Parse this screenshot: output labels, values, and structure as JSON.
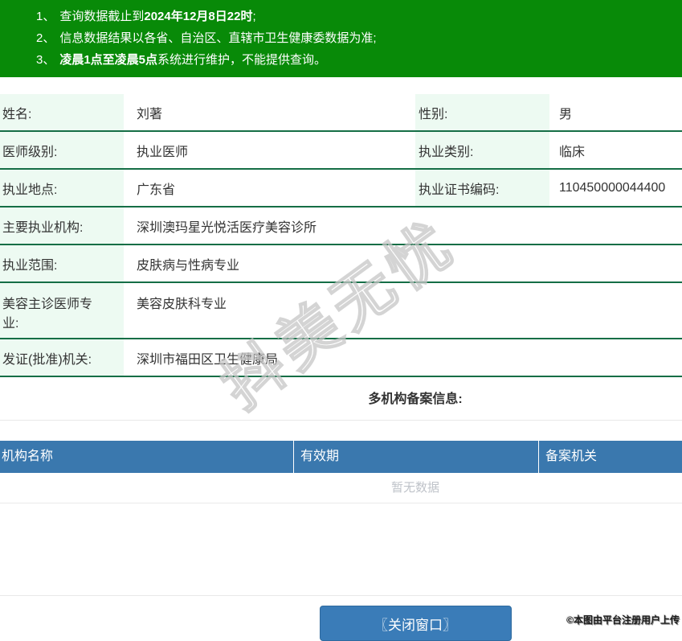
{
  "notices": [
    {
      "num": "1、",
      "pre": "查询数据截止到",
      "bold": "2024年12月8日22时",
      "post": ";"
    },
    {
      "num": "2、",
      "pre": "信息数据结果以各省、自治区、直辖市卫生健康委数据为准;",
      "bold": "",
      "post": ""
    },
    {
      "num": "3、",
      "pre": "",
      "bold": "凌晨1点至凌晨5点",
      "post": "系统进行维护，不能提供查询。"
    }
  ],
  "doctor": {
    "name_label": "姓名:",
    "name": "刘著",
    "gender_label": "性别:",
    "gender": "男",
    "level_label": "医师级别:",
    "level": "执业医师",
    "category_label": "执业类别:",
    "category": "临床",
    "location_label": "执业地点:",
    "location": "广东省",
    "cert_no_label": "执业证书编码:",
    "cert_no": "110450000044400",
    "main_org_label": "主要执业机构:",
    "main_org": "深圳澳玛星光悦活医疗美容诊所",
    "scope_label": "执业范围:",
    "scope": "皮肤病与性病专业",
    "cosmetic_label": "美容主诊医师专业:",
    "cosmetic": "美容皮肤科专业",
    "issuer_label": "发证(批准)机关:",
    "issuer": "深圳市福田区卫生健康局"
  },
  "filing": {
    "title": "多机构备案信息:",
    "columns": [
      "机构名称",
      "有效期",
      "备案机关"
    ],
    "empty_text": "暂无数据"
  },
  "footer": {
    "close_button": "〖关闭窗口〗"
  },
  "watermarks": {
    "diagonal": "抖美无忧",
    "copyright": "©本图由平台注册用户上传"
  },
  "colors": {
    "banner_green": "#088A08",
    "row_border_green": "#156e46",
    "label_bg_mint": "#edfaf2",
    "table_header_blue": "#3a78ae",
    "button_blue": "#3a7cb8",
    "empty_text_gray": "#bfc3c9"
  }
}
